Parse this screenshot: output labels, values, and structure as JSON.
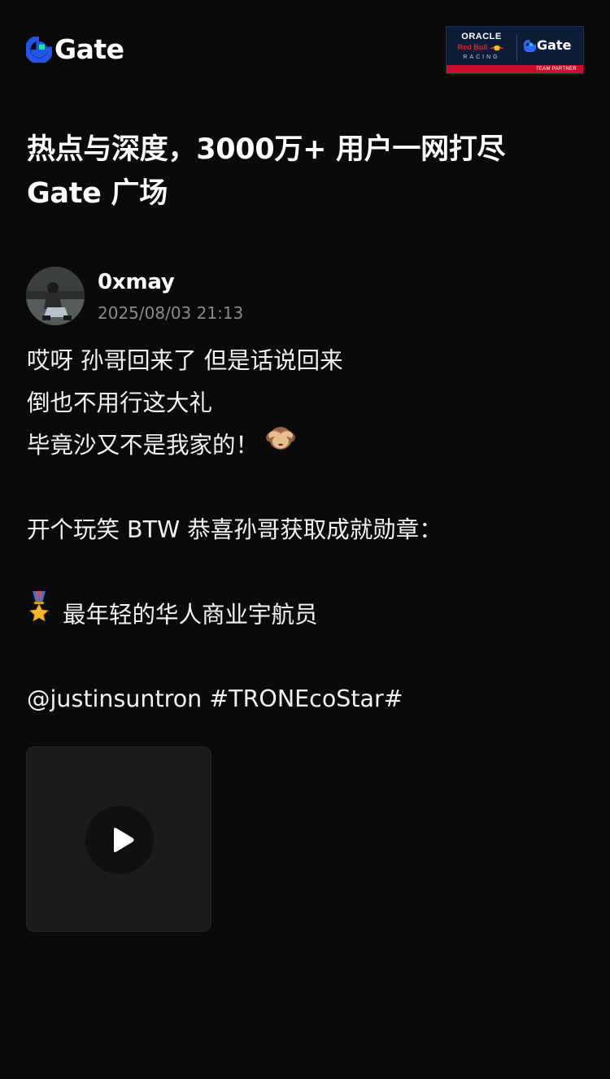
{
  "header": {
    "logo_text": "Gate",
    "partner_badge": {
      "oracle": "ORACLE",
      "redbull": "Red Bull",
      "racing": "RACING",
      "gate": "Gate",
      "strip": "TEAM PARTNER"
    }
  },
  "headline": {
    "line1": "热点与深度，3000万+ 用户一网打尽",
    "line2": "Gate 广场"
  },
  "post": {
    "username": "0xmay",
    "timestamp": "2025/08/03 21:13",
    "lines": {
      "l1": "哎呀 孙哥回来了 但是话说回来",
      "l2": "倒也不用行这大礼",
      "l3": "毕竟沙又不是我家的！",
      "l4": "开个玩笑 BTW 恭喜孙哥获取成就勋章：",
      "l5": "最年轻的华人商业宇航员",
      "mention": "@justinsuntron",
      "hashtag": "#TRONEcoStar#"
    },
    "icons": {
      "emoji": "see-no-evil-monkey-icon",
      "medal": "military-medal-icon",
      "video": "play-icon"
    }
  },
  "colors": {
    "background": "#0a0a0a",
    "brand_blue": "#2354e6",
    "brand_green": "#17e5a1",
    "timestamp_gray": "#8a8a8a",
    "video_card": "#1a1b1d"
  }
}
